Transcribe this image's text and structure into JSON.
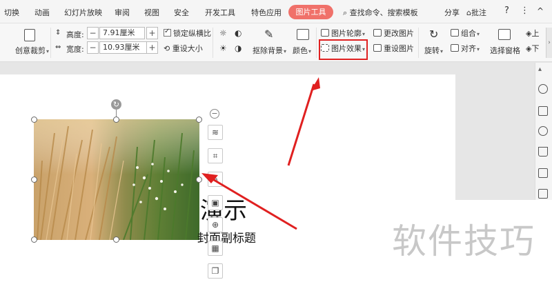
{
  "menubar": {
    "items": [
      "切换",
      "动画",
      "幻灯片放映",
      "审阅",
      "视图",
      "安全",
      "开发工具",
      "特色应用"
    ],
    "active_tab": "图片工具",
    "search_icon": "search-icon",
    "search_label": "查找命令、搜索模板",
    "share": "分享",
    "comment": "批注",
    "help": "?",
    "more": "⋮",
    "collapse": "^"
  },
  "ribbon": {
    "height_label": "高度:",
    "height_value": "7.91厘米",
    "width_label": "宽度:",
    "width_value": "10.93厘米",
    "crop_label": "创意裁剪",
    "lock_ratio": "锁定纵横比",
    "reset_size": "重设大小",
    "remove_bg": "抠除背景",
    "color": "颜色",
    "picture_outline": "图片轮廓",
    "picture_effect": "图片效果",
    "change_picture": "更改图片",
    "reset_picture": "重设图片",
    "rotate": "旋转",
    "group": "组合",
    "align": "对齐",
    "selection_pane": "选择窗格",
    "up": "上",
    "down": "下",
    "plus": "+",
    "minus": "−"
  },
  "slide": {
    "title": "演示",
    "subtitle": "封面副标题"
  },
  "floating_toolbar": {
    "collapse": "−",
    "icons": [
      "layers-icon",
      "crop-icon",
      "edit-icon",
      "picture-icon",
      "zoom-icon",
      "frame-icon",
      "gallery-icon"
    ]
  },
  "watermark": "软件技巧",
  "colors": {
    "accent": "#f0716a",
    "highlight": "#e02020"
  }
}
